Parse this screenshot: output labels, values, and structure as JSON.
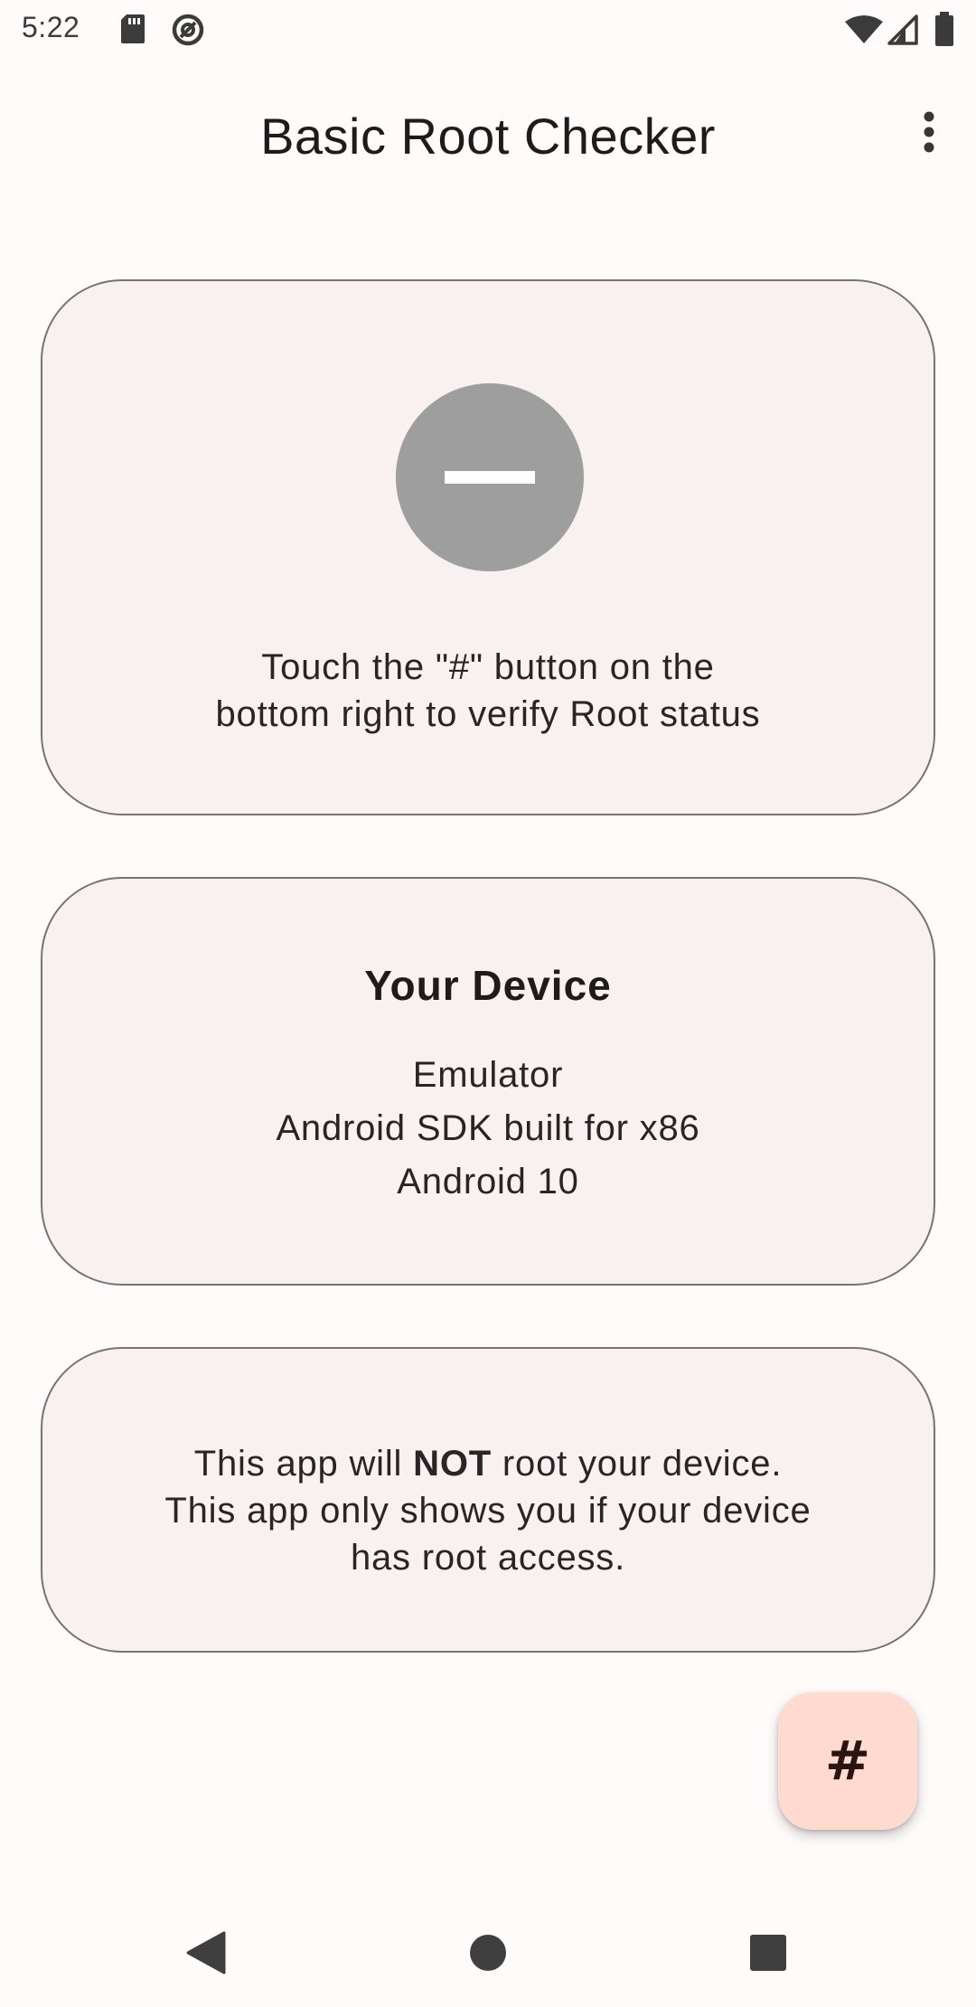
{
  "status_bar": {
    "time": "5:22",
    "icons": [
      "sd-card-icon",
      "at-sign-icon",
      "wifi-icon",
      "cell-signal-icon",
      "battery-icon"
    ]
  },
  "app_bar": {
    "title": "Basic Root Checker",
    "overflow_icon": "more-vert-icon"
  },
  "status_card": {
    "icon": "status-unknown-icon",
    "icon_color": "#9e9e9e",
    "message_line1": "Touch the \"#\" button on the",
    "message_line2": "bottom right to verify Root status"
  },
  "device_card": {
    "heading": "Your Device",
    "model": "Emulator",
    "build": "Android SDK built for x86",
    "os_version": "Android 10"
  },
  "disclaimer_card": {
    "line1_prefix": "This app will ",
    "line1_bold": "NOT",
    "line1_suffix": " root your device.",
    "line2": "This app only shows you if your device",
    "line3": "has root access."
  },
  "fab": {
    "label": "#",
    "color": "#ffdbcf"
  },
  "nav_bar": {
    "back_icon": "back-triangle-icon",
    "home_icon": "home-circle-icon",
    "recents_icon": "recents-square-icon"
  },
  "colors": {
    "background": "#fffbfb",
    "card_background": "#f8f1f0",
    "card_border": "#7a7272"
  }
}
